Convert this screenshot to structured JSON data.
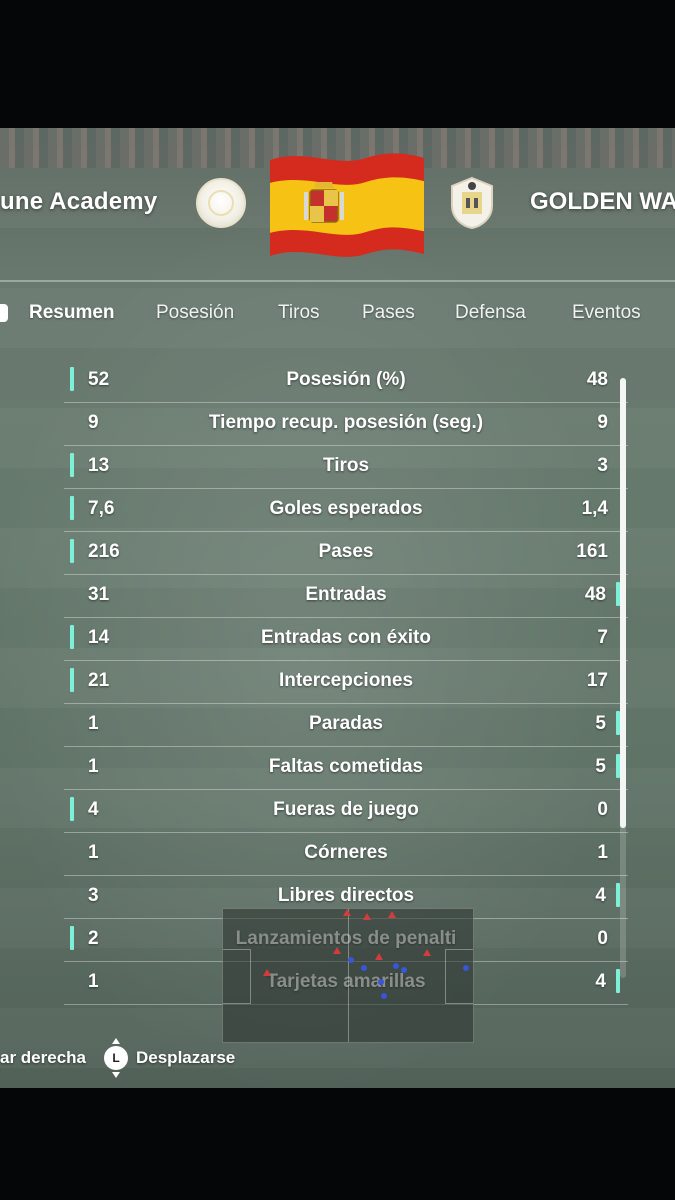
{
  "header": {
    "home_team": "une Academy",
    "away_team": "GOLDEN WA",
    "flag_icon": "spain-flag-icon"
  },
  "tabs": [
    {
      "label": "Resumen",
      "active": true
    },
    {
      "label": "Posesión",
      "active": false
    },
    {
      "label": "Tiros",
      "active": false
    },
    {
      "label": "Pases",
      "active": false
    },
    {
      "label": "Defensa",
      "active": false
    },
    {
      "label": "Eventos",
      "active": false
    }
  ],
  "stats": [
    {
      "label": "Posesión (%)",
      "home": "52",
      "away": "48",
      "leader": "home"
    },
    {
      "label": "Tiempo recup. posesión (seg.)",
      "home": "9",
      "away": "9",
      "leader": "none"
    },
    {
      "label": "Tiros",
      "home": "13",
      "away": "3",
      "leader": "home"
    },
    {
      "label": "Goles esperados",
      "home": "7,6",
      "away": "1,4",
      "leader": "home"
    },
    {
      "label": "Pases",
      "home": "216",
      "away": "161",
      "leader": "home"
    },
    {
      "label": "Entradas",
      "home": "31",
      "away": "48",
      "leader": "away"
    },
    {
      "label": "Entradas con éxito",
      "home": "14",
      "away": "7",
      "leader": "home"
    },
    {
      "label": "Intercepciones",
      "home": "21",
      "away": "17",
      "leader": "home"
    },
    {
      "label": "Paradas",
      "home": "1",
      "away": "5",
      "leader": "away"
    },
    {
      "label": "Faltas cometidas",
      "home": "1",
      "away": "5",
      "leader": "away"
    },
    {
      "label": "Fueras de juego",
      "home": "4",
      "away": "0",
      "leader": "home"
    },
    {
      "label": "Córneres",
      "home": "1",
      "away": "1",
      "leader": "none"
    },
    {
      "label": "Libres directos",
      "home": "3",
      "away": "4",
      "leader": "away"
    },
    {
      "label": "Lanzamientos de penalti",
      "home": "2",
      "away": "0",
      "leader": "home"
    },
    {
      "label": "Tarjetas amarillas",
      "home": "1",
      "away": "4",
      "leader": "away"
    }
  ],
  "footer": {
    "left_hint": "ar derecha",
    "scroll_hint": "Desplazarse",
    "stick_label": "L"
  },
  "colors": {
    "leader_bar": "#7ef0d8",
    "text": "#ffffff"
  }
}
